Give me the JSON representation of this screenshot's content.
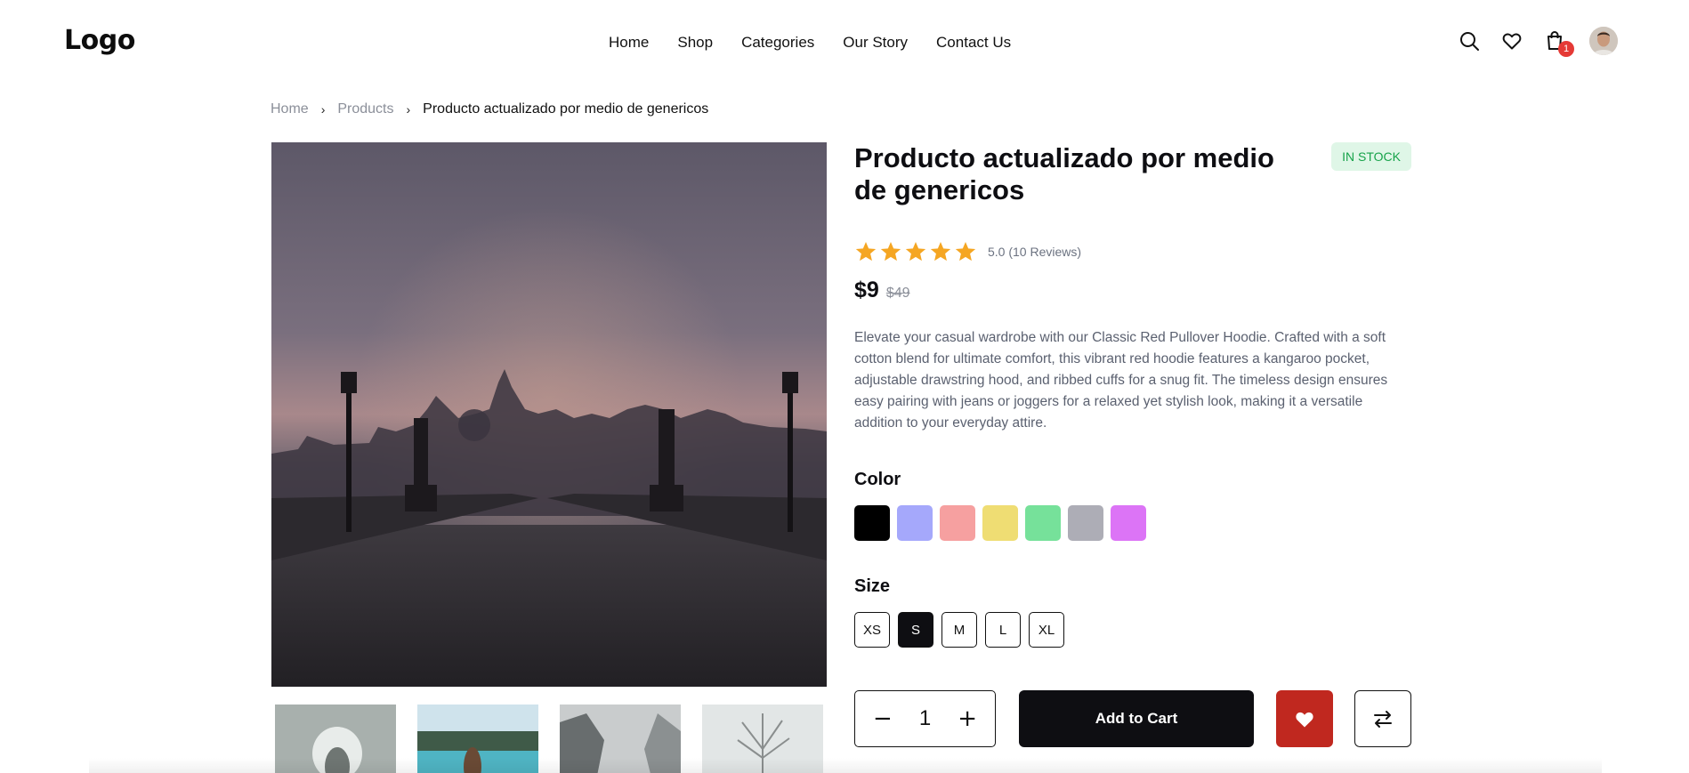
{
  "header": {
    "logo": "Logo",
    "nav": [
      "Home",
      "Shop",
      "Categories",
      "Our Story",
      "Contact Us"
    ],
    "cart_count": "1"
  },
  "breadcrumb": {
    "items": [
      "Home",
      "Products"
    ],
    "current": "Producto actualizado por medio de genericos"
  },
  "product": {
    "title": "Producto actualizado por medio de genericos",
    "stock": "IN STOCK",
    "rating_value": 5,
    "rating_text": "5.0 (10 Reviews)",
    "price": "$9",
    "old_price": "$49",
    "description": "Elevate your casual wardrobe with our Classic Red Pullover Hoodie. Crafted with a soft cotton blend for ultimate comfort, this vibrant red hoodie features a kangaroo pocket, adjustable drawstring hood, and ribbed cuffs for a snug fit. The timeless design ensures easy pairing with jeans or joggers for a relaxed yet stylish look, making it a versatile addition to your everyday attire.",
    "color_label": "Color",
    "colors": [
      "#000000",
      "#a5a8fb",
      "#f6a0a0",
      "#efdd73",
      "#76e19a",
      "#adadb6",
      "#dc74f6"
    ],
    "size_label": "Size",
    "sizes": [
      "XS",
      "S",
      "M",
      "L",
      "XL"
    ],
    "selected_size": "S",
    "quantity": "1",
    "add_to_cart": "Add to Cart"
  },
  "colors": {
    "accent": "#0e0e12",
    "wishlist": "#c0281f",
    "stock_bg": "#dff6e7",
    "stock_text": "#17a34a",
    "star": "#f5a623",
    "badge": "#e53935"
  },
  "icons": {
    "header": [
      "search-icon",
      "heart-icon",
      "cart-icon",
      "avatar"
    ],
    "actions": [
      "minus-icon",
      "plus-icon",
      "heart-icon",
      "compare-arrows-icon"
    ]
  }
}
